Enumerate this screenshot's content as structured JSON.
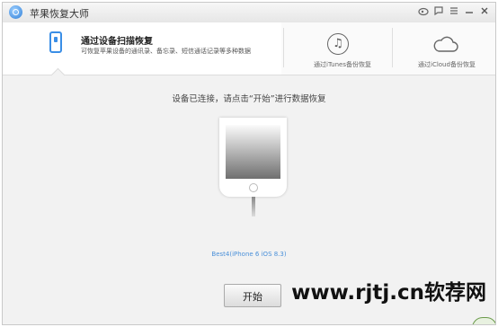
{
  "app": {
    "title": "苹果恢复大师"
  },
  "titlebar": {
    "icons": [
      "weibo-icon",
      "message-icon",
      "menu-icon",
      "minimize-icon",
      "close-icon"
    ]
  },
  "tabs": [
    {
      "title": "通过设备扫描恢复",
      "subtitle": "可恢复苹果设备的通讯录、备忘录、短信通话记录等多种数据",
      "active": true
    },
    {
      "label": "通过iTunes备份恢复",
      "active": false
    },
    {
      "label": "通过iCloud备份恢复",
      "active": false
    }
  ],
  "main": {
    "status_text": "设备已连接，请点击“开始”进行数据恢复",
    "device_label": "Best4(iPhone 6 iOS 8.3)",
    "start_label": "开始"
  },
  "watermark": "www.rjtj.cn软荐网",
  "colors": {
    "accent": "#3a8ee6",
    "link": "#4a90d9"
  }
}
